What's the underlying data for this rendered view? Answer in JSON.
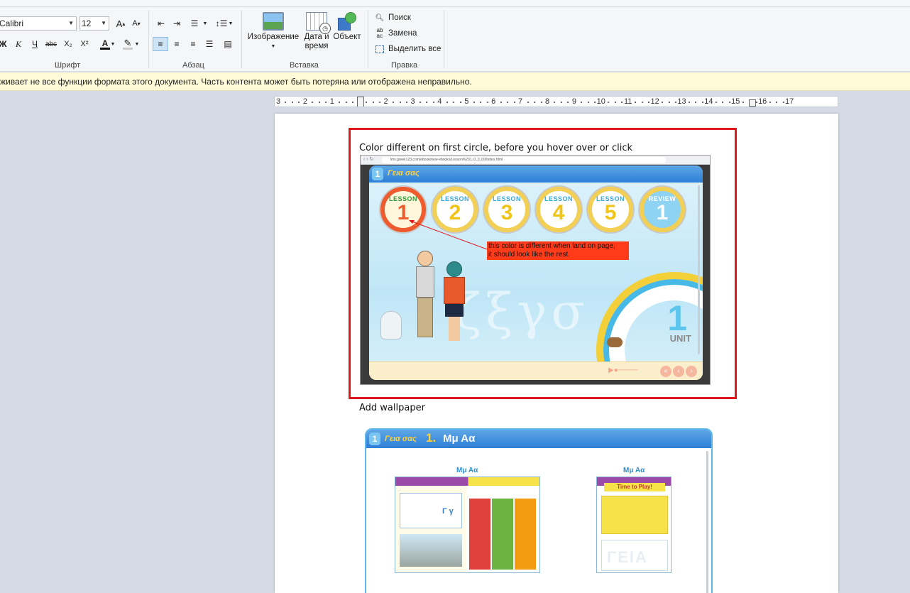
{
  "ribbon": {
    "font": {
      "name": "Calibri",
      "size": "12",
      "label": "Шрифт",
      "format_buttons": [
        "Ж",
        "К",
        "Ч",
        "abc",
        "X₂",
        "X²"
      ]
    },
    "paragraph": {
      "label": "Абзац"
    },
    "insert": {
      "label": "Вставка",
      "image": "Изображение",
      "datetime_line1": "Дата и",
      "datetime_line2": "время",
      "object": "Объект"
    },
    "edit": {
      "label": "Правка",
      "find": "Поиск",
      "replace": "Замена",
      "select_all": "Выделить все"
    }
  },
  "infobar": {
    "text": "живает не все функции формата этого документа. Часть контента может быть потеряна или отображена неправильно."
  },
  "ruler": {
    "marks": [
      "3",
      "2",
      "1",
      "1",
      "2",
      "3",
      "4",
      "5",
      "6",
      "7",
      "8",
      "9",
      "10",
      "11",
      "12",
      "13",
      "14",
      "15",
      "16",
      "17"
    ]
  },
  "document": {
    "caption1": "Color different  on first circle, before you hover over or click",
    "caption2": "Add wallpaper",
    "shot1": {
      "url": "lms.greek123.com/ebook/new-ebooks/Lesson%201_0_0_00/index.html",
      "logo": "Γεια σας",
      "circles": [
        {
          "word": "LESSON",
          "num": "1"
        },
        {
          "word": "LESSON",
          "num": "2"
        },
        {
          "word": "LESSON",
          "num": "3"
        },
        {
          "word": "LESSON",
          "num": "4"
        },
        {
          "word": "LESSON",
          "num": "5"
        },
        {
          "word": "REVIEW",
          "num": "1"
        }
      ],
      "note_line1": "this color is different when land on page,",
      "note_line2": "it should look like the rest.",
      "unit_number": "1",
      "unit_label": "UNIT"
    },
    "shot2": {
      "logo": "Γεια σας",
      "lesson_number": "1.",
      "lesson_title": "Μμ Αα",
      "thumb1_title": "Μμ Αα",
      "thumb2_title": "Μμ Αα",
      "thumb2_heading": "Time to Play!",
      "thumb2_word": "ΓΕΙΑ",
      "thumb1_letters": "Γ γ"
    }
  },
  "colors": {
    "highlight_border": "#e01818",
    "note_bg": "#ff3b1a",
    "accent_blue": "#2d7fd6"
  }
}
